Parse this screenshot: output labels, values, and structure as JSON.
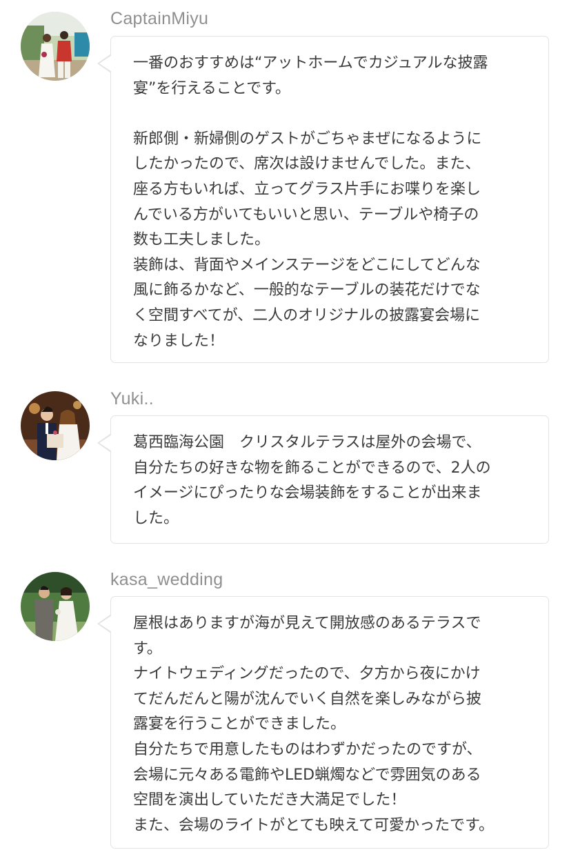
{
  "reviews": [
    {
      "username": "CaptainMiyu",
      "avatar_icon": "user-avatar-photo",
      "text": "一番のおすすめは“アットホームでカジュアルな披露\n宴”を行えることです。\n\n新郎側・新婦側のゲストがごちゃまぜになるように\nしたかったので、席次は設けませんでした。また、\n座る方もいれば、立ってグラス片手にお喋りを楽し\nんでいる方がいてもいいと思い、テーブルや椅子の\n数も工夫しました。\n装飾は、背面やメインステージをどこにしてどんな\n風に飾るかなど、一般的なテーブルの装花だけでな\nく空間すべてが、二人のオリジナルの披露宴会場に\nなりました！"
    },
    {
      "username": "Yuki..",
      "avatar_icon": "user-avatar-photo",
      "text": "葛西臨海公園　クリスタルテラスは屋外の会場で、\n自分たちの好きな物を飾ることができるので、2人の\nイメージにぴったりな会場装飾をすることが出来ま\nした。"
    },
    {
      "username": "kasa_wedding",
      "avatar_icon": "user-avatar-photo",
      "text": "屋根はありますが海が見えて開放感のあるテラスで\nす。\nナイトウェディングだったので、夕方から夜にかけ\nてだんだんと陽が沈んでいく自然を楽しみながら披\n露宴を行うことができました。\n自分たちで用意したものはわずかだったのですが、\n会場に元々ある電飾やLED蝋燭などで雰囲気のある\n空間を演出していただき大満足でした！\nまた、会場のライトがとても映えて可愛かったです。"
    }
  ],
  "colors": {
    "username": "#8f8f8f",
    "text": "#3a3a3a",
    "border": "#e3e3e3"
  }
}
